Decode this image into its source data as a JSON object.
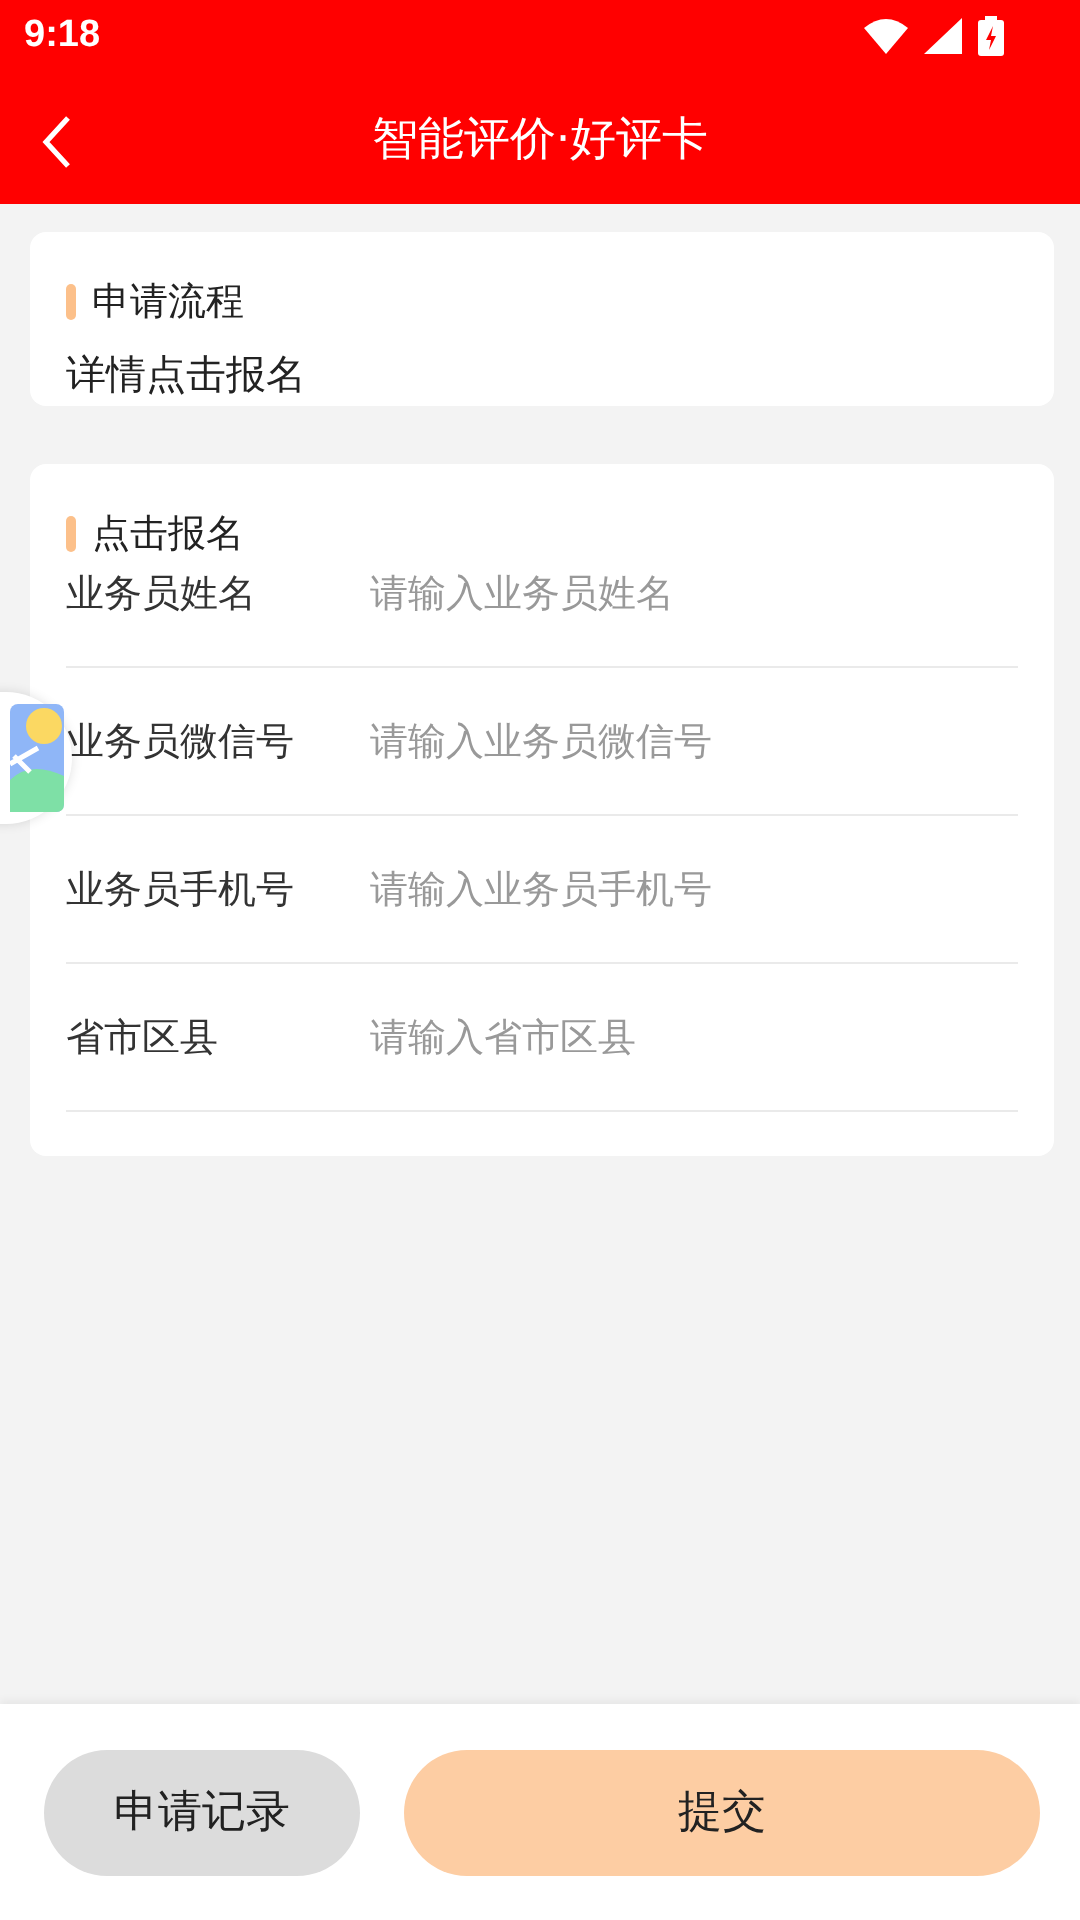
{
  "status_bar": {
    "time": "9:18"
  },
  "header": {
    "title": "智能评价·好评卡"
  },
  "process_card": {
    "title": "申请流程",
    "text": "详情点击报名"
  },
  "signup_card": {
    "title": "点击报名",
    "fields": [
      {
        "label": "业务员姓名",
        "placeholder": "请输入业务员姓名"
      },
      {
        "label": "业务员微信号",
        "placeholder": "请输入业务员微信号"
      },
      {
        "label": "业务员手机号",
        "placeholder": "请输入业务员手机号"
      },
      {
        "label": "省市区县",
        "placeholder": "请输入省市区县"
      }
    ]
  },
  "buttons": [
    {
      "label": "申请记录",
      "kind": "secondary"
    },
    {
      "label": "提交",
      "kind": "primary"
    }
  ]
}
